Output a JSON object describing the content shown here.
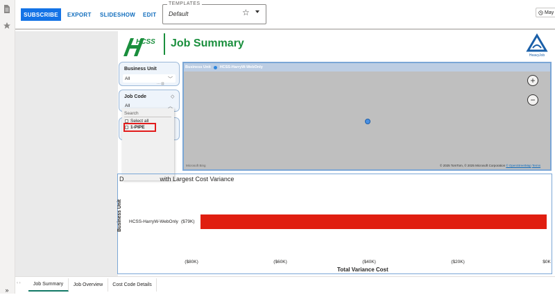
{
  "toolbar": {
    "subscribe": "SUBSCRIBE",
    "export": "EXPORT",
    "slideshow": "SLIDESHOW",
    "edit": "EDIT",
    "templates_label": "TEMPLATES",
    "templates_value": "Default",
    "date_label": "May"
  },
  "header": {
    "logo_text": "HCSS",
    "title": "Job Summary",
    "hj_logo_text": "HeavyJob"
  },
  "slicers": {
    "business_unit": {
      "title": "Business Unit",
      "value": "All"
    },
    "job_code": {
      "title": "Job Code",
      "value": "All",
      "search_placeholder": "Search",
      "options": [
        "Select all",
        "1-PIPE"
      ]
    }
  },
  "map": {
    "legend_title": "Business Unit",
    "legend_item": "HCSS-HarryW-WebOnly",
    "attribution": "© 2025 TomTom, © 2025 Microsoft Corporation",
    "attribution_link": "© OpenStreetMap",
    "terms": "Terms",
    "brand": "Microsoft Bing",
    "zoom_in": "+",
    "zoom_out": "−"
  },
  "chart_data": {
    "type": "bar",
    "orientation": "horizontal",
    "title": "D        with Largest Cost Variance",
    "title_visible": "with Largest Cost Variance",
    "title_prefix": "D",
    "ylabel": "Business Unit",
    "xlabel": "Total Variance Cost",
    "categories": [
      "HCSS-HarryW-WebOnly"
    ],
    "values": [
      -79
    ],
    "data_labels": [
      "($79K)"
    ],
    "xlim": [
      -80,
      0
    ],
    "x_ticks": [
      -80,
      -60,
      -40,
      -20,
      0
    ],
    "x_tick_labels": [
      "($80K)",
      "($60K)",
      "($40K)",
      "($20K)",
      "$0K"
    ],
    "bar_color": "#e01e10"
  },
  "tabs": [
    {
      "label": "Job Summary",
      "active": true
    },
    {
      "label": "Job Overview",
      "active": false
    },
    {
      "label": "Cost Code Details",
      "active": false
    }
  ],
  "colors": {
    "accent": "#1473e6",
    "brand_green": "#1a8f3d",
    "bar": "#e01e10"
  }
}
